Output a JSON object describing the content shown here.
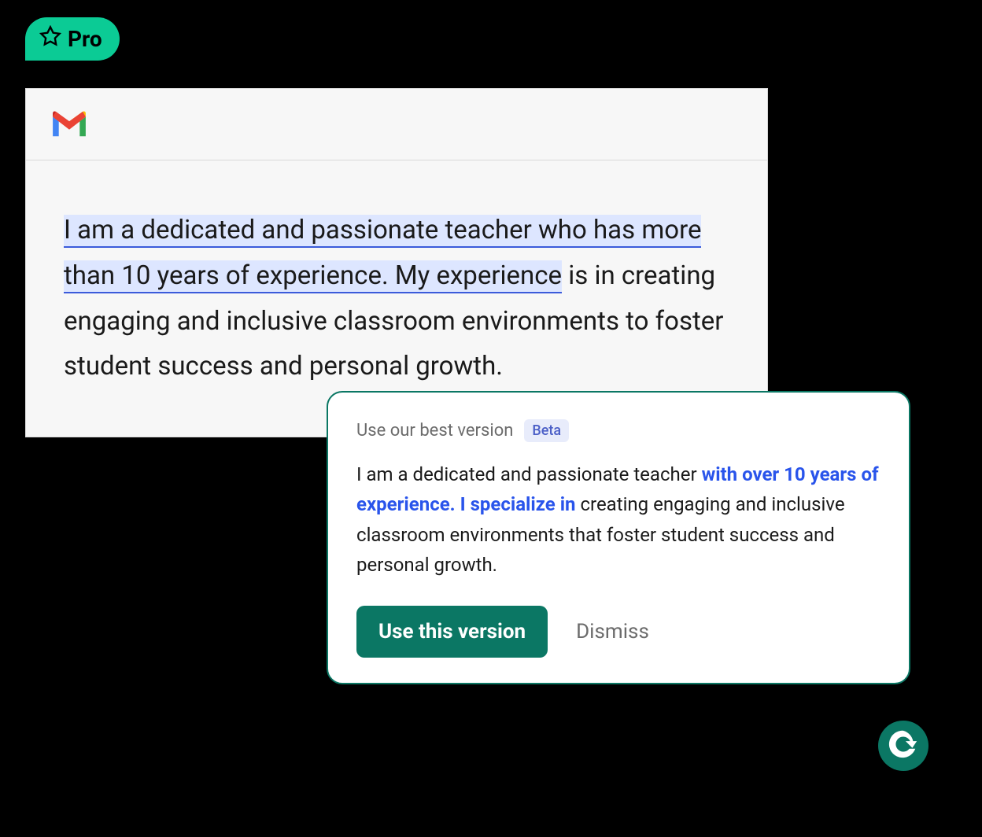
{
  "badge": {
    "label": "Pro"
  },
  "email": {
    "highlighted_text": "I am a dedicated and passionate teacher who has more than 10 years of experience. My experience",
    "remaining_text": " is in creating engaging and inclusive classroom environments to foster student success and personal growth."
  },
  "suggestion": {
    "title": "Use our best version",
    "beta_label": "Beta",
    "text_part1": "I am a dedicated and passionate teacher ",
    "text_highlight": "with over 10 years of experience. I specialize in",
    "text_part2": " creating engaging and inclusive classroom environments that foster student success and personal growth.",
    "use_button": "Use this version",
    "dismiss_button": "Dismiss"
  }
}
